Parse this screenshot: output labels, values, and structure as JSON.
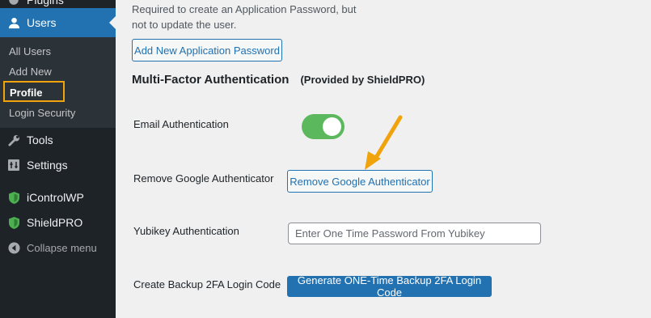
{
  "sidebar": {
    "plugins_label": "Plugins",
    "users_label": "Users",
    "submenu": {
      "all_users": "All Users",
      "add_new": "Add New",
      "profile": "Profile",
      "login_security": "Login Security"
    },
    "tools_label": "Tools",
    "settings_label": "Settings",
    "icontrolwp_label": "iControlWP",
    "shieldpro_label": "ShieldPRO",
    "collapse_label": "Collapse menu"
  },
  "main": {
    "app_password_desc": "Required to create an Application Password, but not to update the user.",
    "add_app_password_button": "Add New Application Password",
    "mfa_heading": "Multi-Factor Authentication",
    "mfa_provider": "(Provided by ShieldPRO)",
    "email_auth_label": "Email Authentication",
    "email_auth_enabled": true,
    "remove_google_label": "Remove Google Authenticator",
    "remove_google_button": "Remove Google Authenticator",
    "yubikey_label": "Yubikey Authentication",
    "yubikey_placeholder": "Enter One Time Password From Yubikey",
    "backup_label": "Create Backup 2FA Login Code",
    "backup_button": "Generate ONE-Time Backup 2FA Login Code"
  },
  "colors": {
    "sidebar_bg": "#1d2327",
    "accent": "#2271b1",
    "toggle_on": "#5cb85c",
    "highlight": "#f0a30a"
  }
}
